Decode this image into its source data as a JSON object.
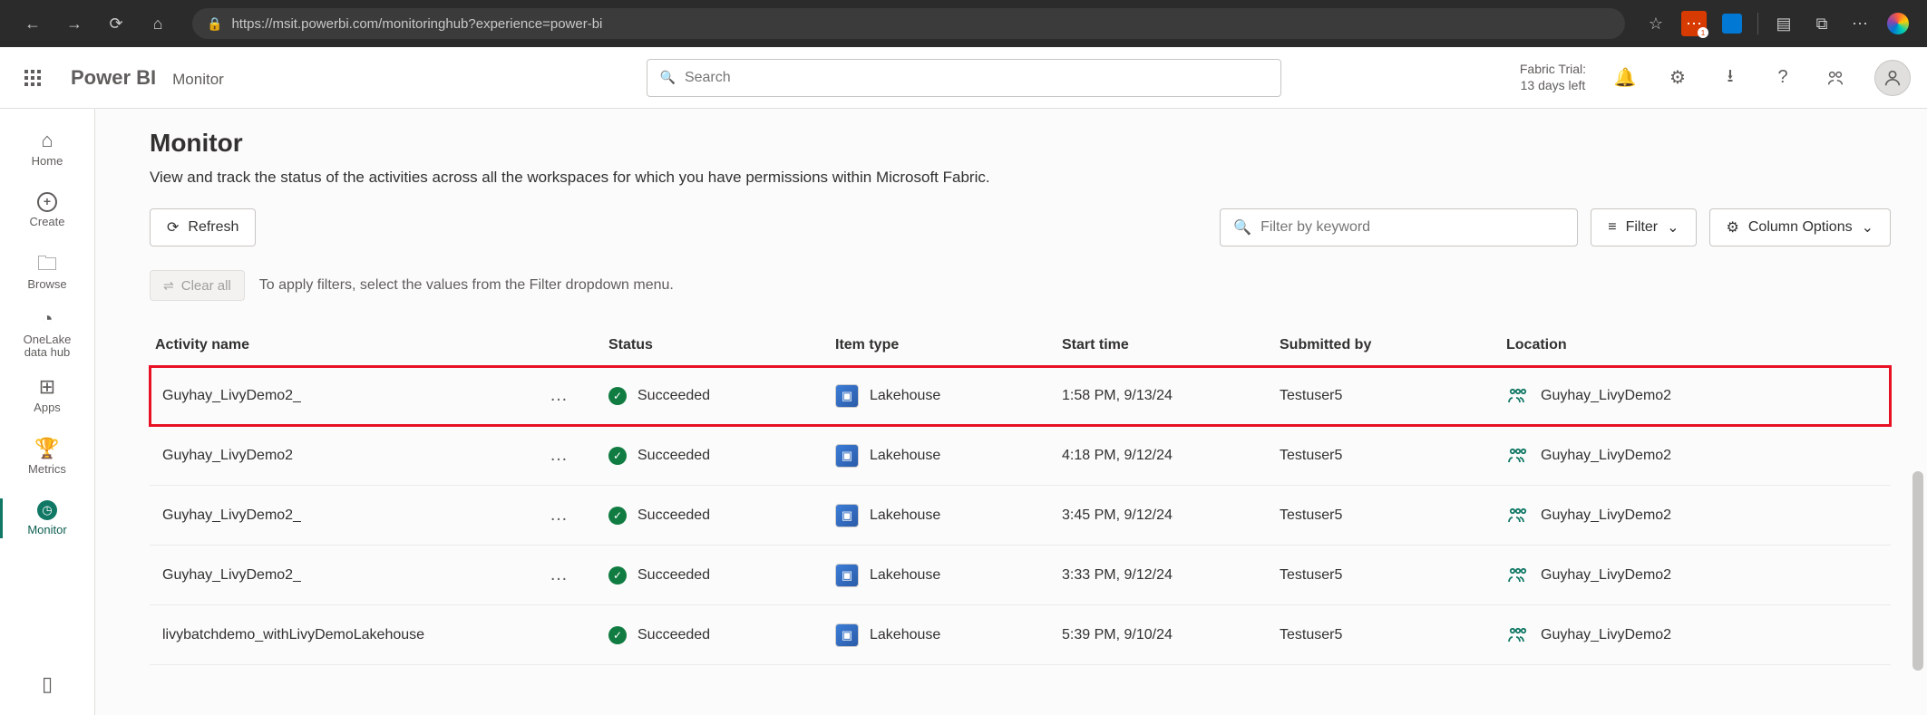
{
  "browser": {
    "url": "https://msit.powerbi.com/monitoringhub?experience=power-bi",
    "ext_badge": "1"
  },
  "header": {
    "brand": "Power BI",
    "crumb": "Monitor",
    "search_placeholder": "Search",
    "trial_line1": "Fabric Trial:",
    "trial_line2": "13 days left"
  },
  "rail": {
    "home": "Home",
    "create": "Create",
    "browse": "Browse",
    "onelake1": "OneLake",
    "onelake2": "data hub",
    "apps": "Apps",
    "metrics": "Metrics",
    "monitor": "Monitor"
  },
  "page": {
    "title": "Monitor",
    "description": "View and track the status of the activities across all the workspaces for which you have permissions within Microsoft Fabric.",
    "refresh": "Refresh",
    "filter_placeholder": "Filter by keyword",
    "filter_btn": "Filter",
    "column_options": "Column Options",
    "clear_all": "Clear all",
    "clear_hint": "To apply filters, select the values from the Filter dropdown menu."
  },
  "columns": {
    "activity": "Activity name",
    "status": "Status",
    "item_type": "Item type",
    "start_time": "Start time",
    "submitted_by": "Submitted by",
    "location": "Location"
  },
  "rows": [
    {
      "activity": "Guyhay_LivyDemo2_",
      "status": "Succeeded",
      "item_type": "Lakehouse",
      "start_time": "1:58 PM, 9/13/24",
      "submitted_by": "Testuser5",
      "location": "Guyhay_LivyDemo2",
      "highlight": true,
      "more": "…"
    },
    {
      "activity": "Guyhay_LivyDemo2",
      "status": "Succeeded",
      "item_type": "Lakehouse",
      "start_time": "4:18 PM, 9/12/24",
      "submitted_by": "Testuser5",
      "location": "Guyhay_LivyDemo2",
      "more": "…"
    },
    {
      "activity": "Guyhay_LivyDemo2_",
      "status": "Succeeded",
      "item_type": "Lakehouse",
      "start_time": "3:45 PM, 9/12/24",
      "submitted_by": "Testuser5",
      "location": "Guyhay_LivyDemo2",
      "more": "…"
    },
    {
      "activity": "Guyhay_LivyDemo2_",
      "status": "Succeeded",
      "item_type": "Lakehouse",
      "start_time": "3:33 PM, 9/12/24",
      "submitted_by": "Testuser5",
      "location": "Guyhay_LivyDemo2",
      "more": "…"
    },
    {
      "activity": "livybatchdemo_withLivyDemoLakehouse",
      "status": "Succeeded",
      "item_type": "Lakehouse",
      "start_time": "5:39 PM, 9/10/24",
      "submitted_by": "Testuser5",
      "location": "Guyhay_LivyDemo2",
      "more": ""
    }
  ]
}
